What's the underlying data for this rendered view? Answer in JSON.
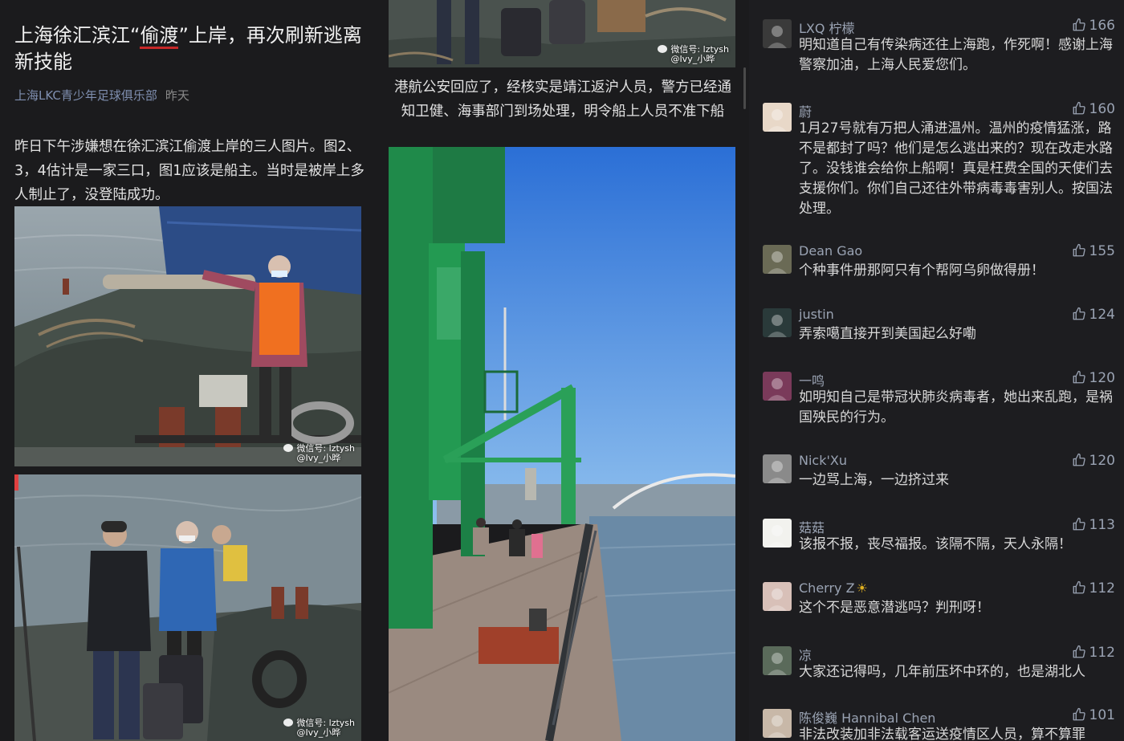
{
  "article": {
    "title_before": "上海徐汇滨江“",
    "title_underlined": "偷渡",
    "title_after": "”上岸，再次刷新逃离新技能",
    "author": "上海LKC青少年足球俱乐部",
    "time": "昨天",
    "paragraph": "昨日下午涉嫌想在徐汇滨江偷渡上岸的三人图片。图2、3，4估计是一家三口，图1应该是船主。当时是被岸上多人制止了，没登陆成功。",
    "mid_paragraph": "港航公安回应了，经核实是靖江返沪人员，警方已经通知卫健、海事部门到场处理，明令船上人员不准下船",
    "watermark_line1": "微信号: lztysh",
    "watermark_line2": "@Ivy_小晔"
  },
  "comments": [
    {
      "name": "LXQ 柠檬",
      "likes": "166",
      "text": "明知道自己有传染病还往上海跑，作死啊！感谢上海警察加油，上海人民爱您们。",
      "avatar_color": "#3a3a3a",
      "avatar_icon": "portrait-avatar"
    },
    {
      "name": "蔚",
      "likes": "160",
      "text": "1月27号就有万把人涌进温州。温州的疫情猛涨，路不是都封了吗？他们是怎么逃出来的？现在改走水路了。没钱谁会给你上船啊！真是枉费全国的天使们去支援你们。你们自己还往外带病毒毒害别人。按国法处理。",
      "avatar_color": "#e8d8c8",
      "avatar_icon": "baby-avatar"
    },
    {
      "name": "Dean Gao",
      "likes": "155",
      "text": "个种事件册那阿只有个帮阿乌卵做得册！",
      "avatar_color": "#6a6a55",
      "avatar_icon": "object-avatar"
    },
    {
      "name": "justin",
      "likes": "124",
      "text": "弄索噶直接开到美国起么好嘞",
      "avatar_color": "#2a3a3a",
      "avatar_icon": "cartoon-avatar"
    },
    {
      "name": "一鸣",
      "likes": "120",
      "text": "如明知自己是带冠状肺炎病毒者，她出来乱跑，是祸国殃民的行为。",
      "avatar_color": "#7a3a5a",
      "avatar_icon": "city-avatar"
    },
    {
      "name": "Nick'Xu",
      "likes": "120",
      "text": "一边骂上海，一边挤过来",
      "avatar_color": "#8a8a8a",
      "avatar_icon": "portrait-avatar"
    },
    {
      "name": "菇菇",
      "likes": "113",
      "text": "该报不报，丧尽福报。该隔不隔，天人永隔！",
      "avatar_color": "#f2f2ee",
      "avatar_icon": "drawing-avatar"
    },
    {
      "name": "Cherry Z",
      "likes": "112",
      "text": "这个不是恶意潜逃吗？判刑呀！",
      "avatar_color": "#d8c0b8",
      "avatar_icon": "child-avatar",
      "badge": "☀"
    },
    {
      "name": "凉",
      "likes": "112",
      "text": "大家还记得吗，几年前压坏中环的，也是湖北人",
      "avatar_color": "#5a6a5a",
      "avatar_icon": "outdoor-avatar"
    },
    {
      "name": "陈俊巍 Hannibal Chen",
      "likes": "101",
      "text": "非法改装加非法载客运送疫情区人员，算不算罪",
      "avatar_color": "#c8b8a8",
      "avatar_icon": "portrait-avatar"
    }
  ]
}
